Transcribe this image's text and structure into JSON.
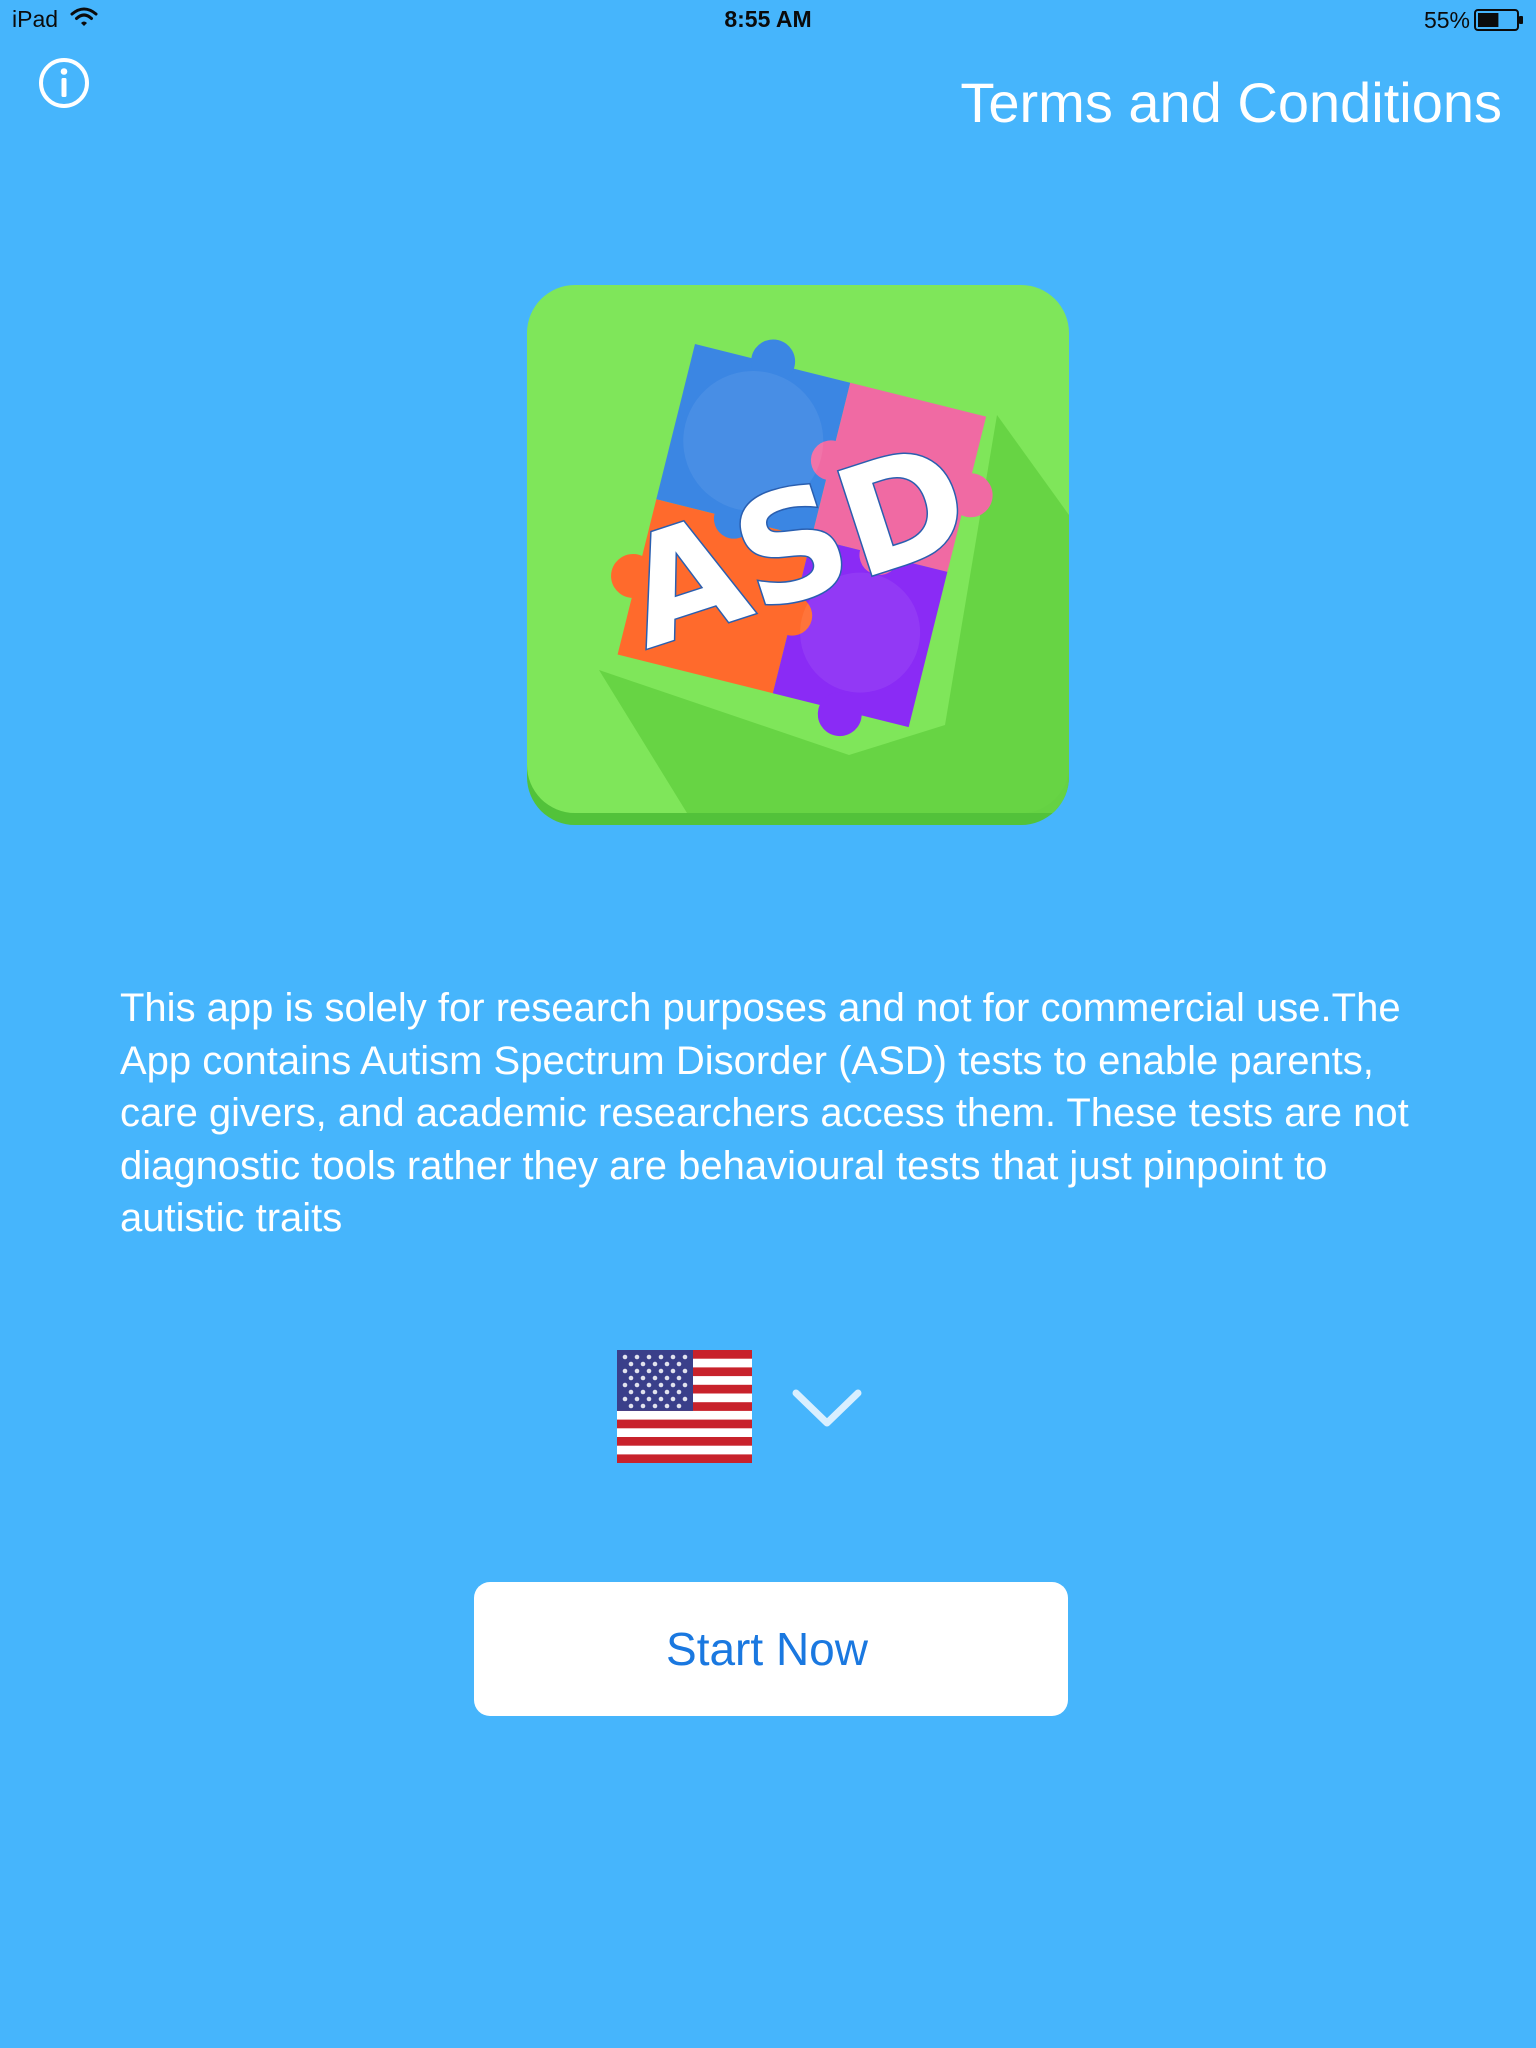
{
  "status_bar": {
    "device": "iPad",
    "time": "8:55 AM",
    "battery_percent": "55%",
    "battery_level": 0.55,
    "icons": [
      "wifi-icon",
      "battery-icon"
    ]
  },
  "header": {
    "info_icon": "info-icon",
    "terms_label": "Terms and Conditions"
  },
  "logo": {
    "text": "ASD",
    "icon": "puzzle-icon",
    "colors": {
      "background": "#7fe65a",
      "blue": "#3b86e3",
      "pink": "#f06aa3",
      "orange": "#ff6a2c",
      "purple": "#8a2bf5"
    }
  },
  "description": "This app is solely for research purposes and not for commercial use.The App contains Autism Spectrum Disorder (ASD) tests to enable parents, care givers, and academic researchers access them. These tests are not diagnostic tools rather they are behavioural tests that just pinpoint to autistic traits",
  "language_selector": {
    "flag_icon": "us-flag-icon",
    "chevron_icon": "chevron-down-icon"
  },
  "start_button": {
    "label": "Start Now"
  },
  "colors": {
    "background": "#46b5fc",
    "button_text": "#1a78e0",
    "button_bg": "#ffffff"
  }
}
